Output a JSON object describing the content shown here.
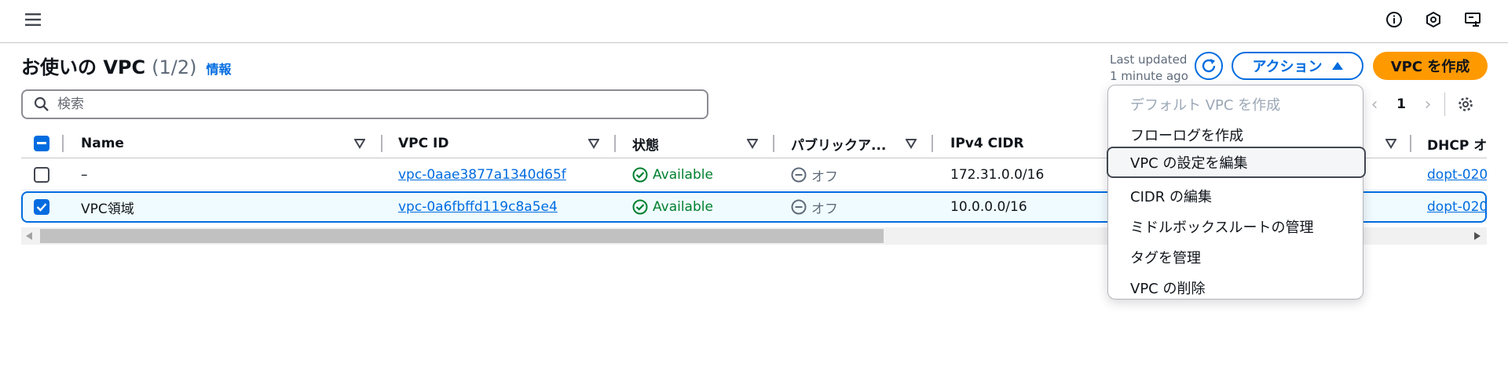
{
  "header": {
    "title": "お使いの VPC",
    "count": "(1/2)",
    "info_link": "情報",
    "last_updated_line1": "Last updated",
    "last_updated_line2": "1 minute ago",
    "actions_label": "アクション",
    "create_label": "VPC を作成"
  },
  "search": {
    "placeholder": "検索",
    "value": ""
  },
  "pagination": {
    "current_page": "1"
  },
  "table": {
    "columns": [
      "Name",
      "VPC ID",
      "状態",
      "パブリックア...",
      "IPv4 CIDR",
      "DHCP オ"
    ],
    "rows": [
      {
        "name": "–",
        "vpc_id": "vpc-0aae3877a1340d65f",
        "status": "Available",
        "public": "オフ",
        "ipv4": "172.31.0.0/16",
        "dhcp": "dopt-020",
        "selected": false
      },
      {
        "name": "VPC領域",
        "vpc_id": "vpc-0a6fbffd119c8a5e4",
        "status": "Available",
        "public": "オフ",
        "ipv4": "10.0.0.0/16",
        "dhcp": "dopt-020",
        "selected": true
      }
    ]
  },
  "actions_menu": {
    "items": [
      {
        "label": "デフォルト VPC を作成",
        "state": "disabled"
      },
      {
        "label": "フローログを作成",
        "state": "normal"
      },
      {
        "label": "VPC の設定を編集",
        "state": "focused"
      },
      {
        "label": "CIDR の編集",
        "state": "normal"
      },
      {
        "label": "ミドルボックスルートの管理",
        "state": "normal"
      },
      {
        "label": "タグを管理",
        "state": "normal"
      },
      {
        "label": "VPC の削除",
        "state": "normal"
      }
    ]
  },
  "icons": {
    "menu": "hamburger-menu-icon",
    "info": "info-icon",
    "notifications": "notifications-icon",
    "feedback": "feedback-icon",
    "refresh": "refresh-icon",
    "search": "search-icon",
    "settings": "gear-icon"
  },
  "colors": {
    "primary": "#006ce0",
    "create_button": "#ff9900",
    "success": "#00802f",
    "text": "#0f141a",
    "muted": "#5f6b7a"
  }
}
